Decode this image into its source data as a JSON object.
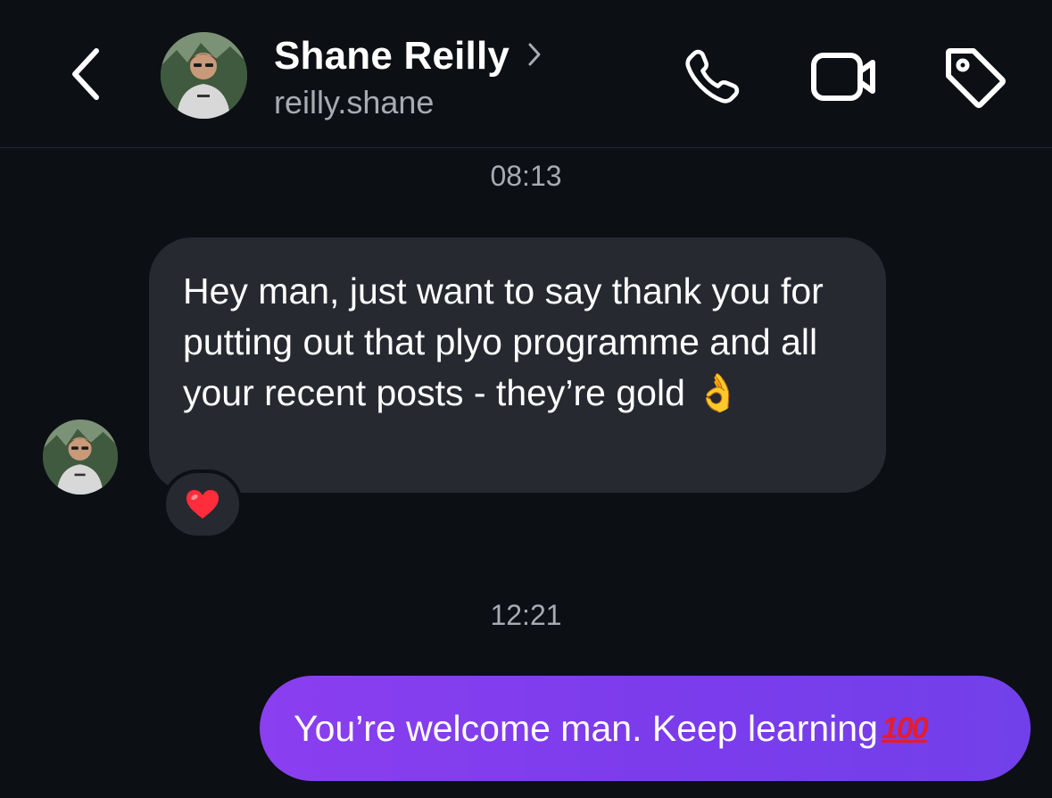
{
  "header": {
    "contact_name": "Shane Reilly",
    "username": "reilly.shane",
    "icons": [
      "back-chevron-icon",
      "phone-icon",
      "video-camera-icon",
      "tag-icon"
    ]
  },
  "messages": [
    {
      "timestamp": "08:13",
      "direction": "incoming",
      "text": "Hey man, just want to say thank you for putting out that plyo programme and all your recent posts - they’re gold",
      "emoji": "👌",
      "reaction": "❤️"
    },
    {
      "timestamp": "12:21",
      "direction": "outgoing",
      "text": "You’re welcome man. Keep learning",
      "emoji": "100"
    }
  ],
  "colors": {
    "background": "#0c0f14",
    "incoming_bubble": "#262930",
    "outgoing_bubble": "#7b3cec",
    "secondary_text": "#a8abb2"
  }
}
